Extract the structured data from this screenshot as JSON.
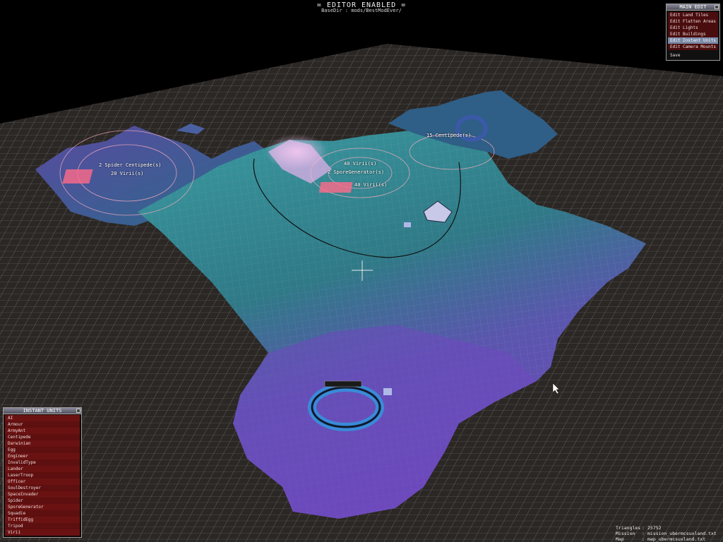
{
  "hud": {
    "title": "= EDITOR ENABLED =",
    "subtitle": "BaseDir : mods/BestModEver/"
  },
  "main_edit": {
    "title": "MAIN EDIT",
    "items": [
      {
        "label": "Edit Land Tiles",
        "selected": false
      },
      {
        "label": "Edit Flatten Areas",
        "selected": false
      },
      {
        "label": "Edit Lights",
        "selected": false
      },
      {
        "label": "Edit Buildings",
        "selected": false
      },
      {
        "label": "Edit Instant Units",
        "selected": true
      },
      {
        "label": "Edit Camera Mounts",
        "selected": false
      }
    ],
    "save": "Save"
  },
  "instant_units": {
    "title": "INSTANT UNITS",
    "items": [
      "AI",
      "Armour",
      "ArmyAnt",
      "Centipede",
      "Darwinian",
      "Egg",
      "Engineer",
      "InvalidType",
      "Lander",
      "LaserTroop",
      "Officer",
      "SoulDestroyer",
      "SpaceInvader",
      "Spider",
      "SporeGenerator",
      "Squadie",
      "TriffidEgg",
      "Tripod",
      "Virii"
    ]
  },
  "world_labels": {
    "left_centipede": "2 Spider Centipede(s)",
    "left_virii": "20 Virii(s)",
    "center_virii_top": "40 Virii(s)",
    "center_spore": "2 SporeGenerator(s)",
    "center_virii_bottom": "40 Virii(s)",
    "right_centipede": "15 Centipede(s)"
  },
  "stats": {
    "triangles_label": "Triangles",
    "triangles_value": "25752",
    "mission_label": "Mission",
    "mission_value": "mission_ubermcsuxland.txt",
    "map_label": "Map",
    "map_value": "map_ubermcsuxland.txt"
  },
  "colors": {
    "terrain_teal": "#2e7c86",
    "terrain_purple": "#6a4fb0",
    "terrain_pink": "#d8a8e8",
    "grid_line": "#6a6a6a",
    "panel_item": "#6a1212",
    "panel_selected": "#7a8aa8"
  }
}
